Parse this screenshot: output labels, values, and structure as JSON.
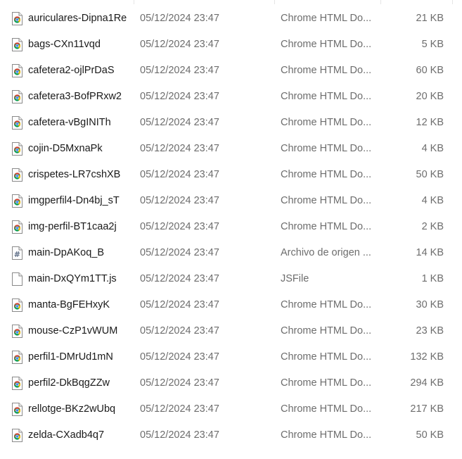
{
  "files": [
    {
      "name": "auriculares-Dipna1Re",
      "date": "05/12/2024 23:47",
      "type": "Chrome HTML Do...",
      "size": "21 KB",
      "icon": "chrome-html-file-icon"
    },
    {
      "name": "bags-CXn11vqd",
      "date": "05/12/2024 23:47",
      "type": "Chrome HTML Do...",
      "size": "5 KB",
      "icon": "chrome-html-file-icon"
    },
    {
      "name": "cafetera2-ojlPrDaS",
      "date": "05/12/2024 23:47",
      "type": "Chrome HTML Do...",
      "size": "60 KB",
      "icon": "chrome-html-file-icon"
    },
    {
      "name": "cafetera3-BofPRxw2",
      "date": "05/12/2024 23:47",
      "type": "Chrome HTML Do...",
      "size": "20 KB",
      "icon": "chrome-html-file-icon"
    },
    {
      "name": "cafetera-vBgINITh",
      "date": "05/12/2024 23:47",
      "type": "Chrome HTML Do...",
      "size": "12 KB",
      "icon": "chrome-html-file-icon"
    },
    {
      "name": "cojin-D5MxnaPk",
      "date": "05/12/2024 23:47",
      "type": "Chrome HTML Do...",
      "size": "4 KB",
      "icon": "chrome-html-file-icon"
    },
    {
      "name": "crispetes-LR7cshXB",
      "date": "05/12/2024 23:47",
      "type": "Chrome HTML Do...",
      "size": "50 KB",
      "icon": "chrome-html-file-icon"
    },
    {
      "name": "imgperfil4-Dn4bj_sT",
      "date": "05/12/2024 23:47",
      "type": "Chrome HTML Do...",
      "size": "4 KB",
      "icon": "chrome-html-file-icon"
    },
    {
      "name": "img-perfil-BT1caa2j",
      "date": "05/12/2024 23:47",
      "type": "Chrome HTML Do...",
      "size": "2 KB",
      "icon": "chrome-html-file-icon"
    },
    {
      "name": "main-DpAKoq_B",
      "date": "05/12/2024 23:47",
      "type": "Archivo de origen ...",
      "size": "14 KB",
      "icon": "css-source-file-icon"
    },
    {
      "name": "main-DxQYm1TT.js",
      "date": "05/12/2024 23:47",
      "type": "JSFile",
      "size": "1 KB",
      "icon": "blank-file-icon"
    },
    {
      "name": "manta-BgFEHxyK",
      "date": "05/12/2024 23:47",
      "type": "Chrome HTML Do...",
      "size": "30 KB",
      "icon": "chrome-html-file-icon"
    },
    {
      "name": "mouse-CzP1vWUM",
      "date": "05/12/2024 23:47",
      "type": "Chrome HTML Do...",
      "size": "23 KB",
      "icon": "chrome-html-file-icon"
    },
    {
      "name": "perfil1-DMrUd1mN",
      "date": "05/12/2024 23:47",
      "type": "Chrome HTML Do...",
      "size": "132 KB",
      "icon": "chrome-html-file-icon"
    },
    {
      "name": "perfil2-DkBqgZZw",
      "date": "05/12/2024 23:47",
      "type": "Chrome HTML Do...",
      "size": "294 KB",
      "icon": "chrome-html-file-icon"
    },
    {
      "name": "rellotge-BKz2wUbq",
      "date": "05/12/2024 23:47",
      "type": "Chrome HTML Do...",
      "size": "217 KB",
      "icon": "chrome-html-file-icon"
    },
    {
      "name": "zelda-CXadb4q7",
      "date": "05/12/2024 23:47",
      "type": "Chrome HTML Do...",
      "size": "50 KB",
      "icon": "chrome-html-file-icon"
    }
  ],
  "colors": {
    "name_text": "#1a1a1a",
    "detail_text": "#6d6d6d",
    "chrome_red": "#db4437",
    "chrome_yellow": "#f4b400",
    "chrome_green": "#0f9d58",
    "chrome_blue": "#4285f4",
    "hover_bg": "#e5f3ff"
  }
}
